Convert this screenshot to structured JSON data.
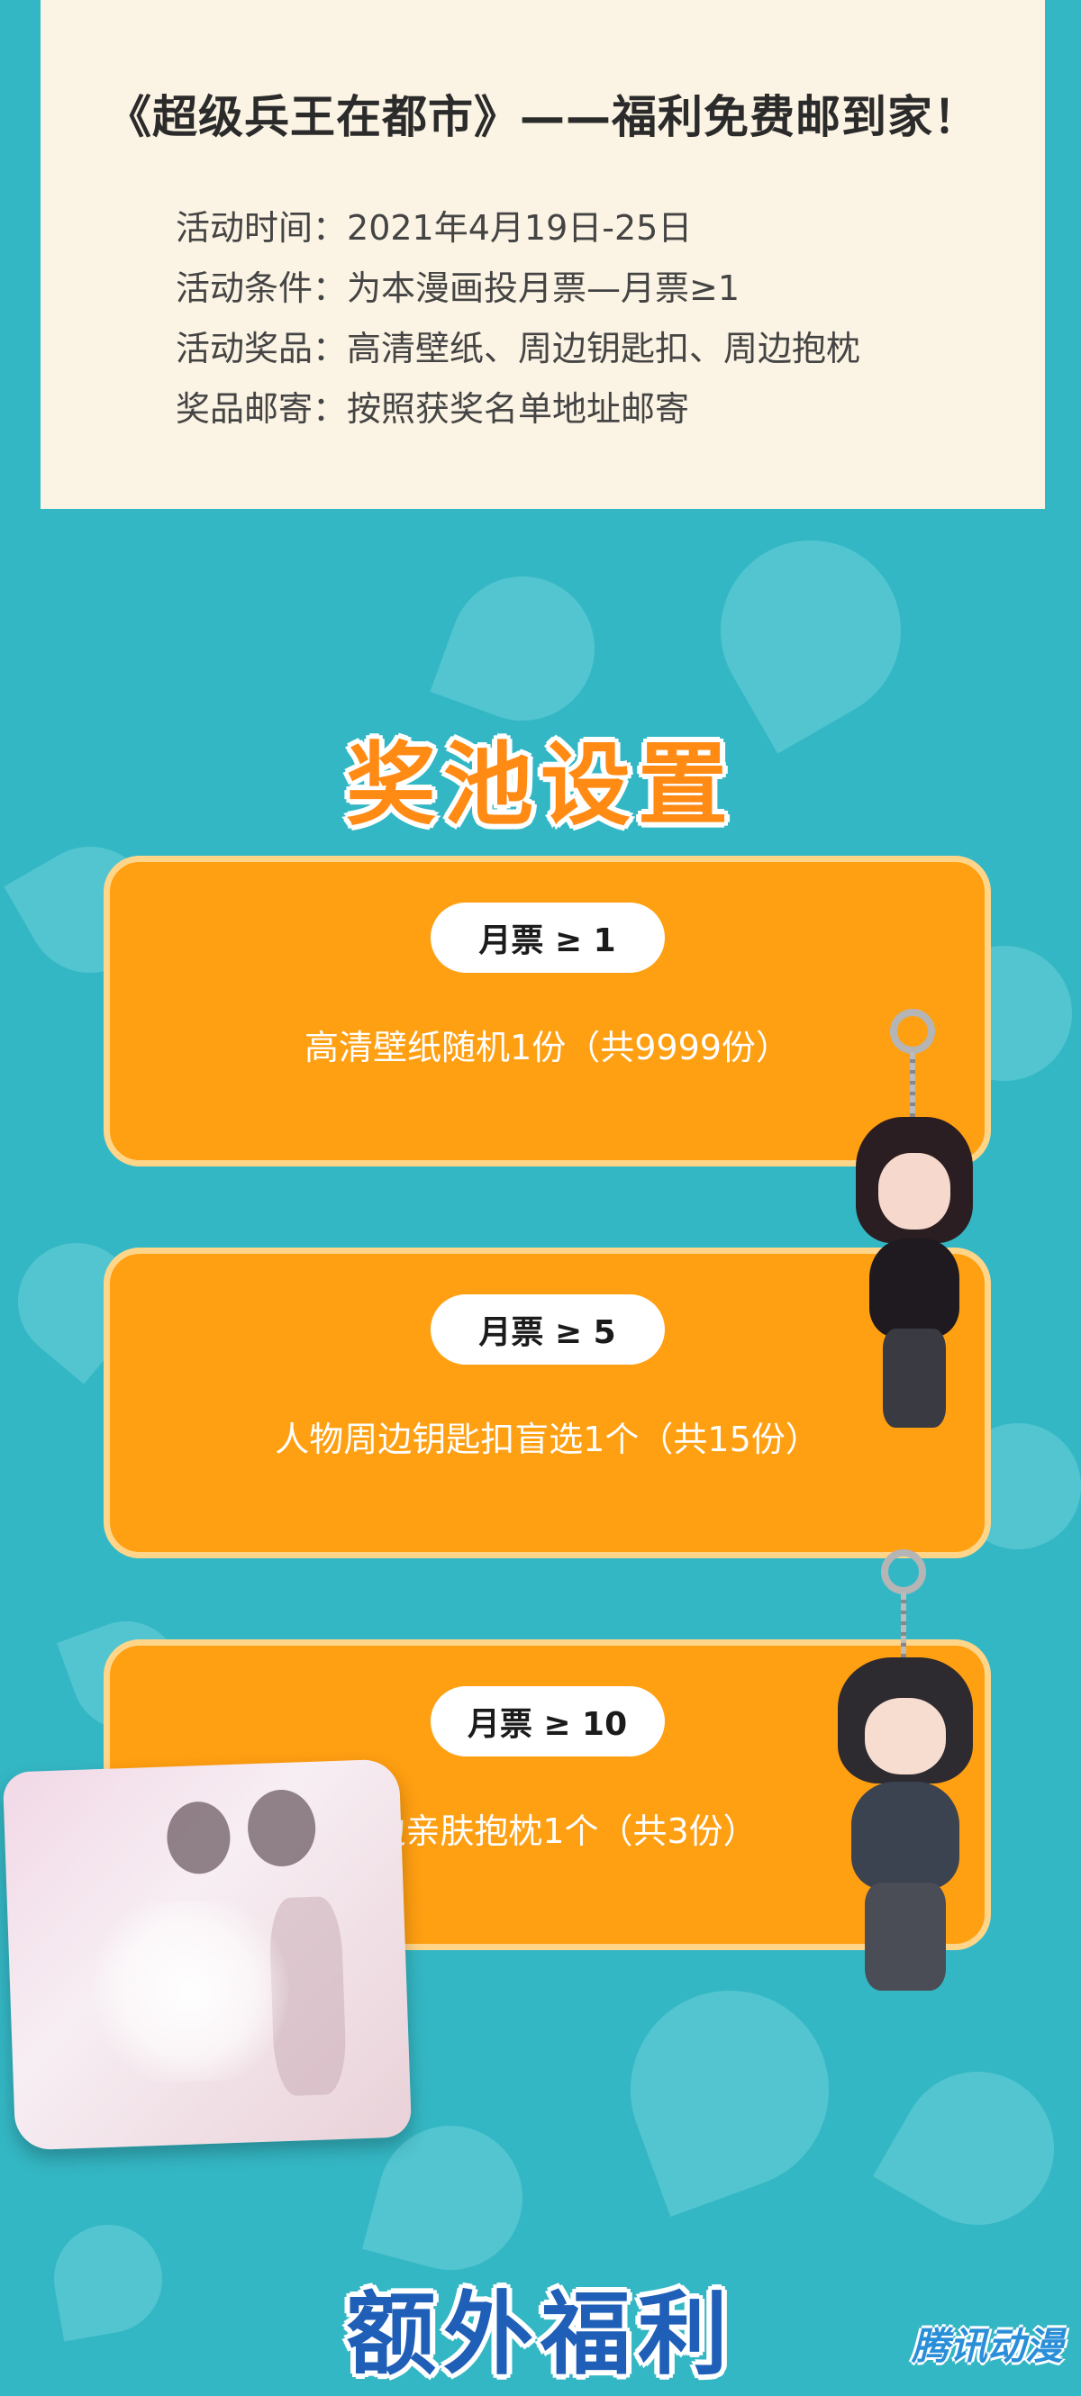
{
  "header": {
    "title": "《超级兵王在都市》——福利免费邮到家！",
    "rows": [
      {
        "label": "活动时间：",
        "value": "2021年4月19日-25日"
      },
      {
        "label": "活动条件：",
        "value": "为本漫画投月票—月票≥1"
      },
      {
        "label": "活动奖品：",
        "value": "高清壁纸、周边钥匙扣、周边抱枕"
      },
      {
        "label": "奖品邮寄：",
        "value": "按照获奖名单地址邮寄"
      }
    ]
  },
  "pool": {
    "title": "奖池设置",
    "tiers": [
      {
        "threshold": "月票 ≥ 1",
        "reward": "高清壁纸随机1份（共9999份）"
      },
      {
        "threshold": "月票 ≥ 5",
        "reward": "人物周边钥匙扣盲选1个（共15份）"
      },
      {
        "threshold": "月票 ≥ 10",
        "reward": "周边亲肤抱枕1个（共3份）"
      }
    ]
  },
  "extra": {
    "title": "额外福利"
  },
  "watermark": "腾讯动漫",
  "colors": {
    "background": "#34b7c4",
    "panel": "#fbf3e3",
    "card": "#ff9f12",
    "card_border": "#ffd58a",
    "pool_title": "#ff8a14",
    "extra_title": "#1f5fb8"
  }
}
